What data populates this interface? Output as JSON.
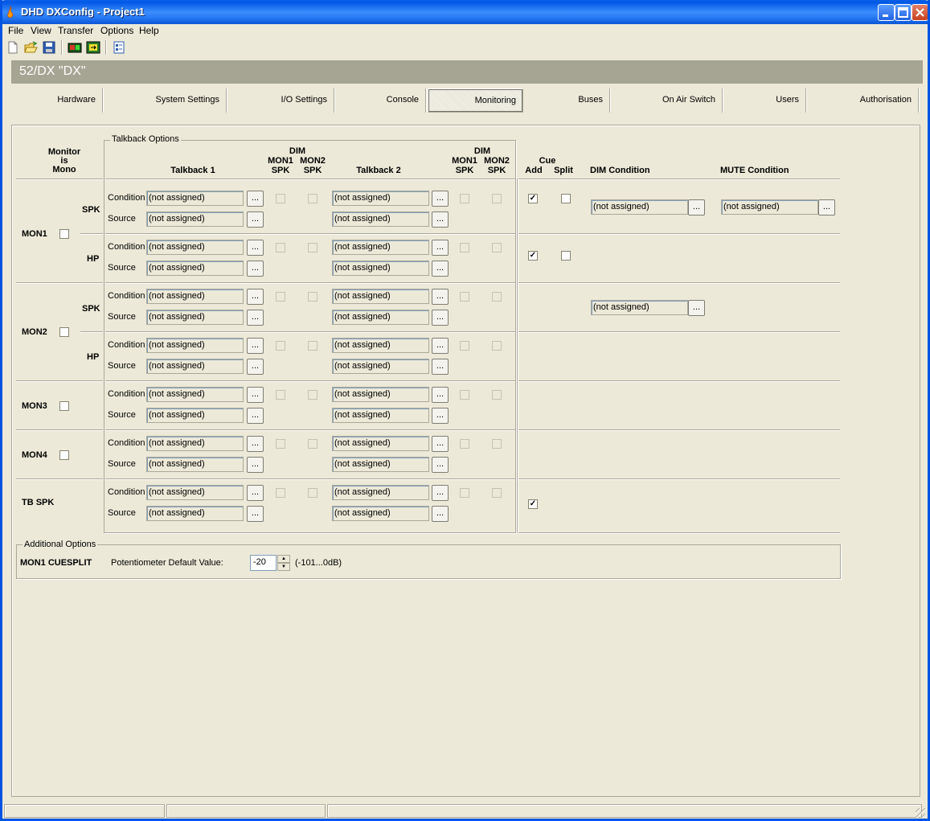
{
  "window": {
    "title": "DHD DXConfig - Project1"
  },
  "menu": [
    "File",
    "View",
    "Transfer",
    "Options",
    "Help"
  ],
  "toolbar_icons": [
    "new-file-icon",
    "open-folder-icon",
    "save-disk-icon",
    "device-online-icon",
    "device-transfer-icon",
    "properties-icon"
  ],
  "device": {
    "banner": "52/DX \"DX\""
  },
  "tabs": [
    "Hardware",
    "System Settings",
    "I/O Settings",
    "Console",
    "Monitoring",
    "Buses",
    "On Air Switch",
    "Users",
    "Authorisation"
  ],
  "active_tab": "Monitoring",
  "headers": {
    "monitor_is_mono": [
      "Monitor",
      "is",
      "Mono"
    ],
    "talkback_options": "Talkback Options",
    "talkback1": "Talkback 1",
    "talkback2": "Talkback 2",
    "dim": "DIM",
    "mon1spk": [
      "MON1",
      "SPK"
    ],
    "mon2spk": [
      "MON2",
      "SPK"
    ],
    "cue": "Cue",
    "add": "Add",
    "split": "Split",
    "dim_condition": "DIM Condition",
    "mute_condition": "MUTE Condition"
  },
  "labels": {
    "condition": "Condition",
    "source": "Source",
    "not_assigned": "(not assigned)",
    "browse": "...",
    "spk": "SPK",
    "hp": "HP"
  },
  "monitors": [
    {
      "name": "MON1",
      "mono": false
    },
    {
      "name": "MON2",
      "mono": false
    },
    {
      "name": "MON3",
      "mono": false
    },
    {
      "name": "MON4",
      "mono": false
    },
    {
      "name": "TB SPK"
    }
  ],
  "cue_rows": [
    {
      "add": true,
      "split": false
    },
    {
      "add": true,
      "split": false
    },
    {
      "add": true
    }
  ],
  "additional": {
    "title": "Additional Options",
    "label": "MON1 CUESPLIT",
    "pot_label": "Potentiometer Default Value:",
    "pot_value": "-20",
    "range": "(-101...0dB)"
  }
}
